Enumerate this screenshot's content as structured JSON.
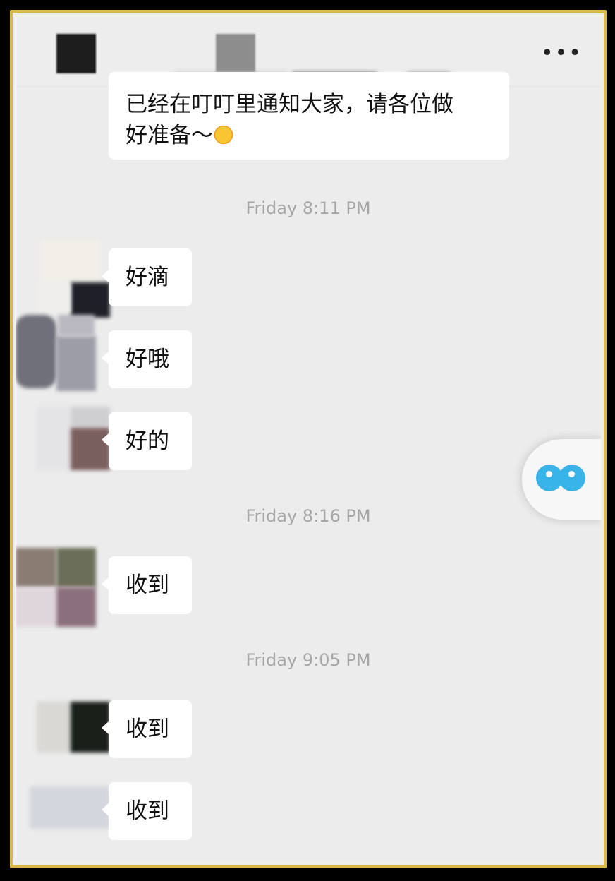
{
  "header": {
    "more_label": "•••"
  },
  "messages": [
    {
      "type": "text",
      "text_line1": "已经在叮叮里通知大家，请各位做",
      "text_line2": "好准备～",
      "emoji": "sun-emoji"
    },
    {
      "type": "timestamp",
      "text": "Friday 8:11 PM"
    },
    {
      "type": "text",
      "text": "好滴"
    },
    {
      "type": "text",
      "text": "好哦"
    },
    {
      "type": "text",
      "text": "好的"
    },
    {
      "type": "timestamp",
      "text": "Friday 8:16 PM"
    },
    {
      "type": "text",
      "text": "收到"
    },
    {
      "type": "timestamp",
      "text": "Friday 9:05 PM"
    },
    {
      "type": "text",
      "text": "收到"
    },
    {
      "type": "text",
      "text": "收到"
    }
  ],
  "colors": {
    "frame_border": "#d9b84a",
    "chat_background": "#ececec",
    "bubble": "#ffffff",
    "timestamp_text": "#a6a6a6",
    "floating_icon": "#39b4e8"
  }
}
